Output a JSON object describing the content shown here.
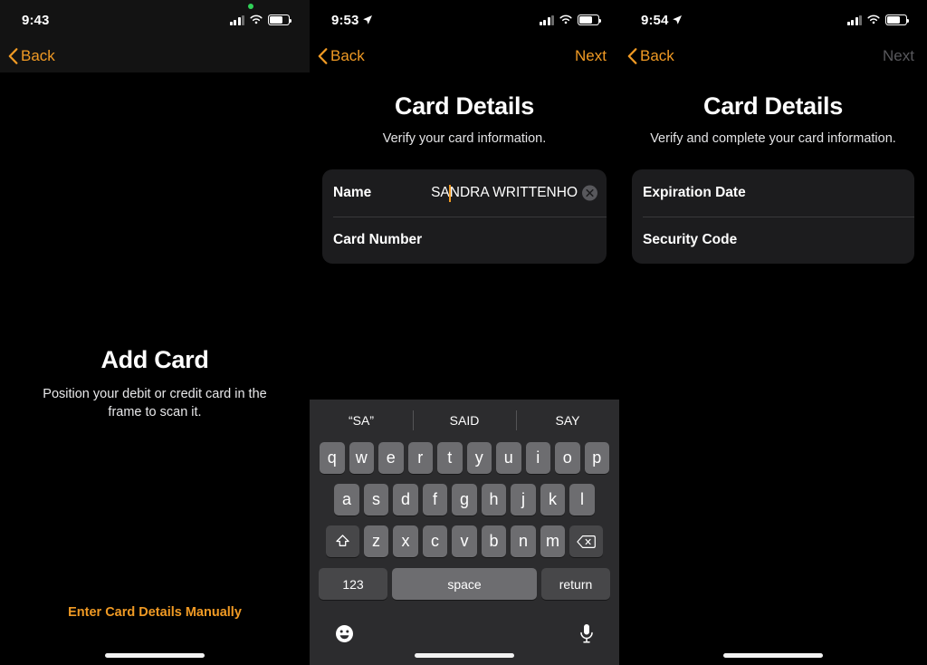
{
  "panels": [
    {
      "id": "scan-card",
      "status": {
        "time": "9:43",
        "location_arrow": false,
        "recording_dot": true,
        "signal": "3 of 4 bars",
        "wifi": "wifi-full",
        "battery": "battery-72"
      },
      "nav": {
        "back_label": "Back",
        "next_label": "",
        "next_enabled": false,
        "tinted": true
      },
      "title": "Add Card",
      "subtitle": "Position your debit or credit card in the frame to scan it.",
      "manual_link": "Enter Card Details Manually"
    },
    {
      "id": "card-details-name",
      "status": {
        "time": "9:53",
        "location_arrow": true,
        "recording_dot": false,
        "signal": "3 of 4 bars",
        "wifi": "wifi-full",
        "battery": "battery-72"
      },
      "nav": {
        "back_label": "Back",
        "next_label": "Next",
        "next_enabled": true,
        "tinted": false
      },
      "title": "Card Details",
      "subtitle": "Verify your card information.",
      "rows": [
        {
          "label": "Name",
          "value_before_caret": "SA",
          "value_after_caret": "NDRA  WRITTENHO",
          "has_caret": true,
          "has_clear": true
        },
        {
          "label": "Card Number",
          "value_before_caret": "",
          "value_after_caret": "",
          "has_caret": false,
          "has_clear": false
        }
      ],
      "keyboard": {
        "predictions": [
          "“SA”",
          "SAID",
          "SAY"
        ],
        "row1": [
          "q",
          "w",
          "e",
          "r",
          "t",
          "y",
          "u",
          "i",
          "o",
          "p"
        ],
        "row2": [
          "a",
          "s",
          "d",
          "f",
          "g",
          "h",
          "j",
          "k",
          "l"
        ],
        "row3": [
          "z",
          "x",
          "c",
          "v",
          "b",
          "n",
          "m"
        ],
        "shift_icon": "shift-icon",
        "delete_icon": "delete-icon",
        "numbers_label": "123",
        "space_label": "space",
        "return_label": "return",
        "emoji_icon": "emoji-icon",
        "dictation_icon": "microphone-icon"
      }
    },
    {
      "id": "card-details-expiry",
      "status": {
        "time": "9:54",
        "location_arrow": true,
        "recording_dot": false,
        "signal": "3 of 4 bars",
        "wifi": "wifi-full",
        "battery": "battery-72"
      },
      "nav": {
        "back_label": "Back",
        "next_label": "Next",
        "next_enabled": false,
        "tinted": false
      },
      "title": "Card Details",
      "subtitle": "Verify and complete your card information.",
      "rows": [
        {
          "label": "Expiration Date",
          "value_before_caret": "",
          "value_after_caret": "",
          "has_caret": false,
          "has_clear": false
        },
        {
          "label": "Security Code",
          "value_before_caret": "",
          "value_after_caret": "",
          "has_caret": false,
          "has_clear": false
        }
      ]
    }
  ],
  "colors": {
    "accent": "#f09a24",
    "disabled": "#58585c",
    "background": "#000000",
    "card": "#1c1c1e",
    "keyboard_bg": "#2c2c2e",
    "key": "#6d6d70",
    "key_dark": "#474749",
    "recording_dot": "#30d158"
  }
}
